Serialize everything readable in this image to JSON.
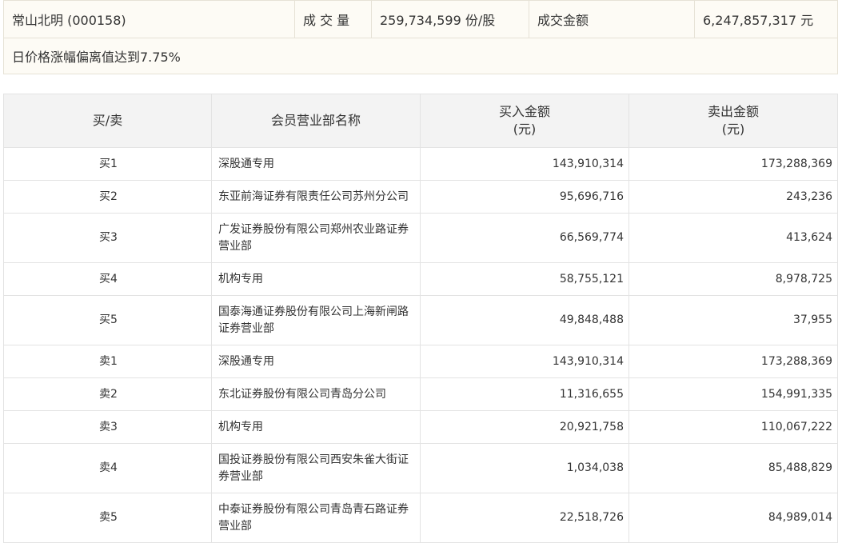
{
  "summary": {
    "stock": "常山北明 (000158)",
    "volume_label": "成 交 量",
    "volume_value": "259,734,599 份/股",
    "amount_label": "成交金额",
    "amount_value": "6,247,857,317 元",
    "reason": "日价格涨幅偏离值达到7.75%"
  },
  "table": {
    "headers": {
      "side": "买/卖",
      "branch": "会员营业部名称",
      "buy_l1": "买入金额",
      "buy_l2": "(元)",
      "sell_l1": "卖出金额",
      "sell_l2": "(元)"
    },
    "rows": [
      {
        "side": "买1",
        "branch": "深股通专用",
        "buy": "143,910,314",
        "sell": "173,288,369"
      },
      {
        "side": "买2",
        "branch": "东亚前海证券有限责任公司苏州分公司",
        "buy": "95,696,716",
        "sell": "243,236"
      },
      {
        "side": "买3",
        "branch": "广发证券股份有限公司郑州农业路证券营业部",
        "buy": "66,569,774",
        "sell": "413,624"
      },
      {
        "side": "买4",
        "branch": "机构专用",
        "buy": "58,755,121",
        "sell": "8,978,725"
      },
      {
        "side": "买5",
        "branch": "国泰海通证券股份有限公司上海新闸路证券营业部",
        "buy": "49,848,488",
        "sell": "37,955"
      },
      {
        "side": "卖1",
        "branch": "深股通专用",
        "buy": "143,910,314",
        "sell": "173,288,369"
      },
      {
        "side": "卖2",
        "branch": "东北证券股份有限公司青岛分公司",
        "buy": "11,316,655",
        "sell": "154,991,335"
      },
      {
        "side": "卖3",
        "branch": "机构专用",
        "buy": "20,921,758",
        "sell": "110,067,222"
      },
      {
        "side": "卖4",
        "branch": "国投证券股份有限公司西安朱雀大街证券营业部",
        "buy": "1,034,038",
        "sell": "85,488,829"
      },
      {
        "side": "卖5",
        "branch": "中泰证券股份有限公司青岛青石路证券营业部",
        "buy": "22,518,726",
        "sell": "84,989,014"
      }
    ]
  }
}
